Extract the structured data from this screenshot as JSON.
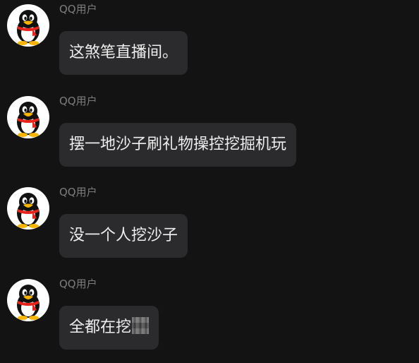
{
  "messages": [
    {
      "sender": "QQ用户",
      "avatar_icon": "qq-penguin-icon",
      "text": "这煞笔直播间。"
    },
    {
      "sender": "QQ用户",
      "avatar_icon": "qq-penguin-icon",
      "text": "摆一地沙子刷礼物操控挖掘机玩"
    },
    {
      "sender": "QQ用户",
      "avatar_icon": "qq-penguin-icon",
      "text": "没一个人挖沙子"
    },
    {
      "sender": "QQ用户",
      "avatar_icon": "qq-penguin-icon",
      "text": "全都在挖"
    }
  ],
  "colors": {
    "background": "#131313",
    "bubble": "#2b2b2d",
    "text": "#eeeeee",
    "sender": "#7d7d7d"
  }
}
